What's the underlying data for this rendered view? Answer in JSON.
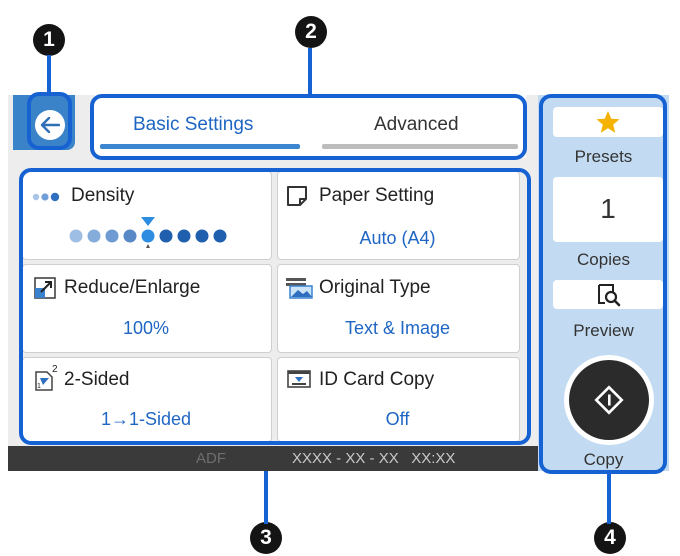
{
  "callouts": [
    "1",
    "2",
    "3",
    "4"
  ],
  "tabs": [
    {
      "label": "Basic Settings",
      "active": true
    },
    {
      "label": "Advanced",
      "active": false
    }
  ],
  "back_icon": "back-arrow-icon",
  "tiles": {
    "density": {
      "title": "Density",
      "level": 5,
      "steps": 9,
      "icon": "density-dots-icon"
    },
    "paper_setting": {
      "title": "Paper Setting",
      "value": "Auto (A4)",
      "icon": "paper-icon"
    },
    "reduce_enlarge": {
      "title": "Reduce/Enlarge",
      "value": "100%",
      "icon": "resize-icon"
    },
    "original_type": {
      "title": "Original Type",
      "value": "Text & Image",
      "icon": "image-icon"
    },
    "two_sided": {
      "title": "2-Sided",
      "value": "1→1-Sided",
      "icon": "two-sided-icon"
    },
    "id_card_copy": {
      "title": "ID Card Copy",
      "value": "Off",
      "icon": "id-card-icon"
    }
  },
  "status_bar": {
    "adf": "ADF",
    "datetime": "XXXX - XX - XX   XX:XX"
  },
  "right_panel": {
    "presets_label": "Presets",
    "copies_value": "1",
    "copies_label": "Copies",
    "preview_label": "Preview",
    "copy_label": "Copy"
  },
  "colors": {
    "accent": "#1762d3",
    "value_text": "#1f66c4",
    "panel": "#c3dbf2",
    "back_button": "#3b83c8"
  }
}
